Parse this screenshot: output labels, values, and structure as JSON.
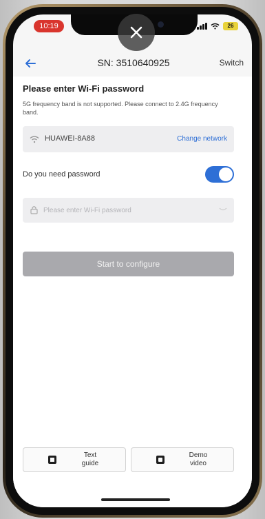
{
  "status_bar": {
    "time": "10:19",
    "battery": "26"
  },
  "overlay": {
    "close_icon": "close-icon"
  },
  "nav": {
    "back_icon": "arrow-left-icon",
    "title": "SN: 3510640925",
    "switch_label": "Switch"
  },
  "wifi_setup": {
    "heading": "Please enter Wi-Fi password",
    "notice": "5G frequency band is not supported. Please connect to 2.4G frequency band.",
    "network": {
      "icon": "wifi-icon",
      "name": "HUAWEI-8A88",
      "change_label": "Change network"
    },
    "password_toggle": {
      "label": "Do you need password",
      "enabled": true
    },
    "password_field": {
      "icon": "lock-icon",
      "value": "",
      "placeholder": "Please enter Wi-Fi password"
    },
    "configure_button": "Start to configure"
  },
  "guides": [
    {
      "icon": "document-icon",
      "label_line1": "Text",
      "label_line2": "guide"
    },
    {
      "icon": "video-icon",
      "label_line1": "Demo",
      "label_line2": "video"
    }
  ],
  "colors": {
    "accent": "#2e6fd6",
    "disabled_button": "#a9a9ad",
    "status_time_bg": "#d9352d",
    "battery_bg": "#e8d23a"
  }
}
